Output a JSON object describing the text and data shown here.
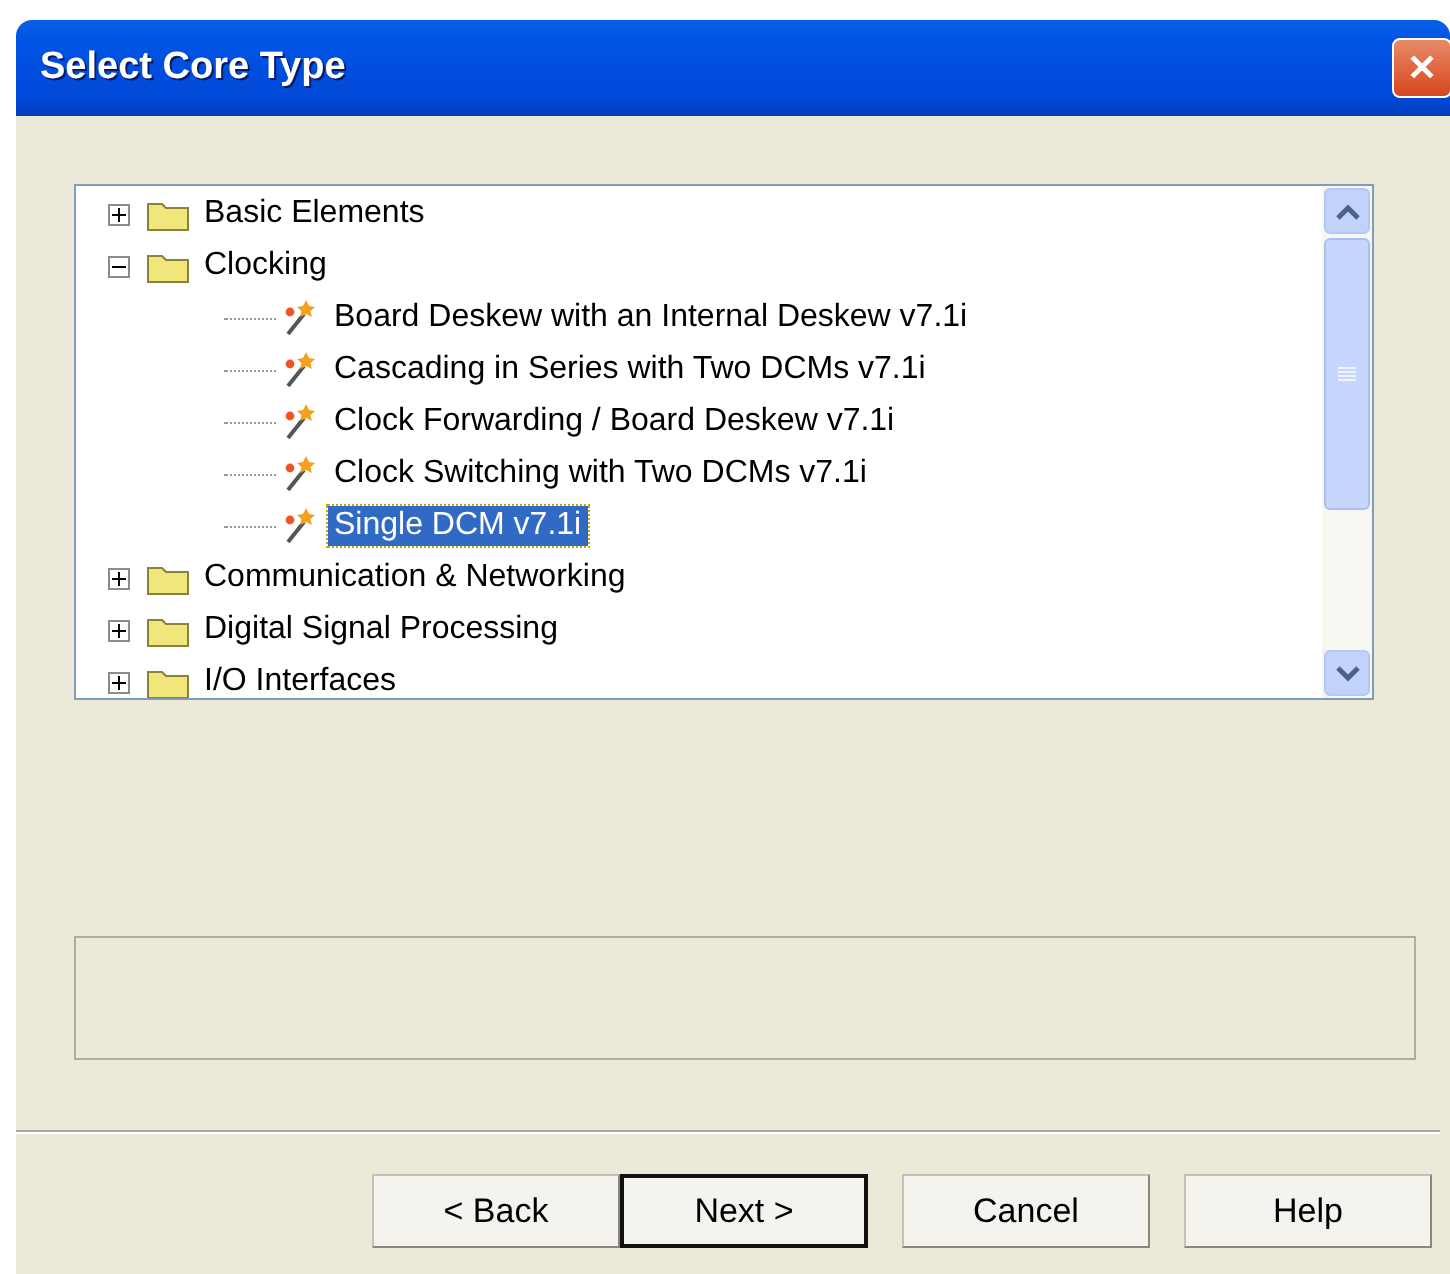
{
  "window": {
    "title": "Select Core Type",
    "close": "✕"
  },
  "tree": [
    {
      "label": "Basic Elements",
      "expanded": false
    },
    {
      "label": "Clocking",
      "expanded": true,
      "children": [
        {
          "label": "Board Deskew with an Internal Deskew v7.1i",
          "selected": false
        },
        {
          "label": "Cascading in Series with Two DCMs v7.1i",
          "selected": false
        },
        {
          "label": "Clock Forwarding / Board Deskew v7.1i",
          "selected": false
        },
        {
          "label": "Clock Switching with Two DCMs v7.1i",
          "selected": false
        },
        {
          "label": "Single DCM v7.1i",
          "selected": true
        }
      ]
    },
    {
      "label": "Communication & Networking",
      "expanded": false
    },
    {
      "label": "Digital Signal Processing",
      "expanded": false
    },
    {
      "label": "I/O Interfaces",
      "expanded": false
    }
  ],
  "buttons": [
    {
      "label": "< Back",
      "default": false
    },
    {
      "label": "Next >",
      "default": true
    },
    {
      "label": "Cancel",
      "default": false
    },
    {
      "label": "Help",
      "default": false
    }
  ]
}
